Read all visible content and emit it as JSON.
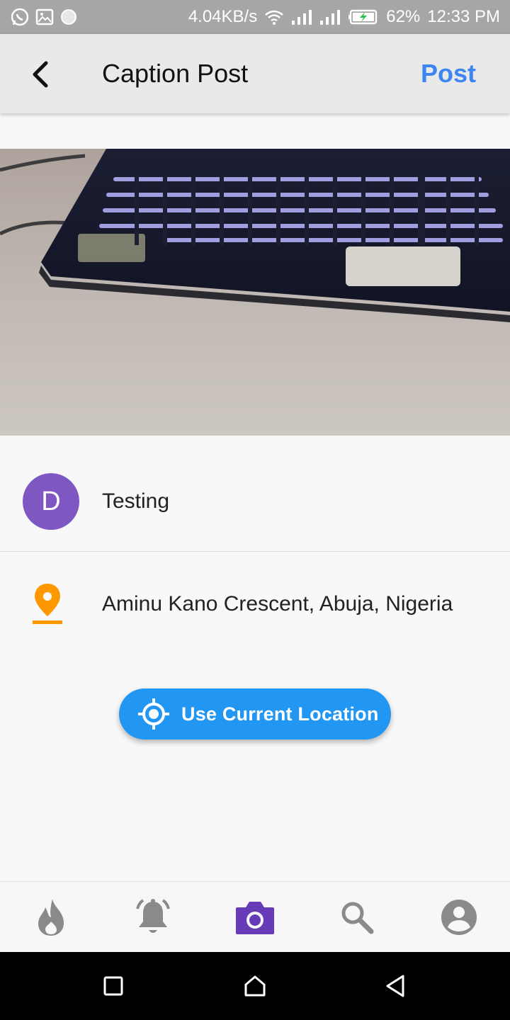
{
  "status_bar": {
    "network_speed": "4.04KB/s",
    "battery": "62%",
    "time": "12:33 PM"
  },
  "app_bar": {
    "title": "Caption Post",
    "post_label": "Post"
  },
  "caption": {
    "avatar_letter": "D",
    "text": "Testing",
    "avatar_color": "#7e57c2"
  },
  "location": {
    "text": "Aminu Kano Crescent, Abuja, Nigeria",
    "pin_color": "#ff9800"
  },
  "use_location_button": {
    "label": "Use Current Location",
    "color": "#2196f3"
  },
  "bottom_nav": {
    "items": [
      {
        "icon": "flame-icon",
        "active": false
      },
      {
        "icon": "bell-icon",
        "active": false
      },
      {
        "icon": "camera-icon",
        "active": true
      },
      {
        "icon": "search-icon",
        "active": false
      },
      {
        "icon": "account-icon",
        "active": false
      }
    ],
    "active_color": "#673ab7",
    "inactive_color": "#8a8a8a"
  },
  "colors": {
    "accent": "#3d86f2",
    "background": "#f8f8f8"
  }
}
